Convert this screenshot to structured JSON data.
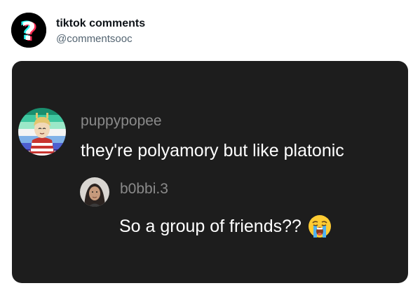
{
  "account": {
    "name": "tiktok comments",
    "handle": "@commentsooc",
    "avatar_icon": "question-mark-logo-icon",
    "avatar_glyph": "?"
  },
  "comment": {
    "username": "puppypopee",
    "text": "they're polyamory but like platonic",
    "avatar_icon": "pride-flag-avatar-icon"
  },
  "reply": {
    "username": "b0bbi.3",
    "text": "So a group of friends??",
    "avatar_icon": "profile-photo-avatar-icon",
    "emoji_icon": "loudly-crying-face-emoji-icon"
  },
  "colors": {
    "card_background": "#1d1d1d",
    "username_gray": "#8a8a8a",
    "comment_text": "#ffffff",
    "handle_gray": "#536471",
    "logo_cyan": "#25f4ee",
    "logo_red": "#fe2c55"
  }
}
